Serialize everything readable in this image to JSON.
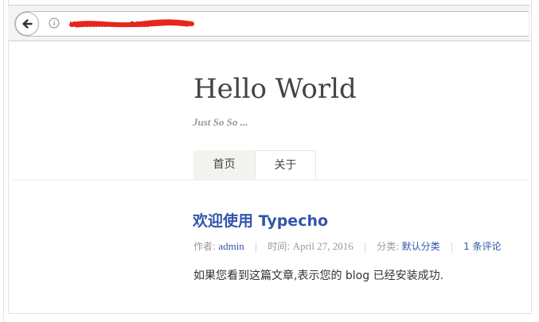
{
  "browser": {
    "url_text": "www.............com",
    "back_icon": "back-arrow-icon",
    "info_icon": "info-icon"
  },
  "site": {
    "title": "Hello World",
    "description": "Just So So ..."
  },
  "nav": {
    "items": [
      {
        "label": "首页",
        "active": true
      },
      {
        "label": "关于",
        "active": false
      }
    ]
  },
  "post": {
    "title": "欢迎使用 Typecho",
    "meta": {
      "author_label": "作者:",
      "author": "admin",
      "time_label": "时间:",
      "time": "April 27, 2016",
      "category_label": "分类:",
      "category": "默认分类",
      "comments": "1 条评论"
    },
    "body": "如果您看到这篇文章,表示您的 blog 已经安装成功."
  },
  "colors": {
    "link": "#3354aa",
    "redaction": "#e8251c"
  }
}
